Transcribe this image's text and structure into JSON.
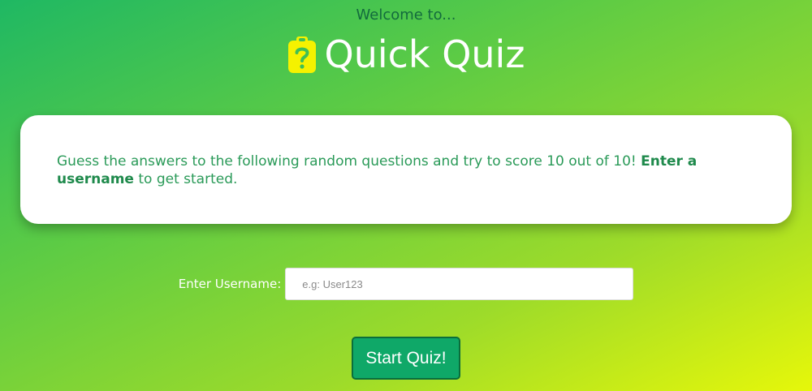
{
  "header": {
    "welcome": "Welcome to...",
    "title": "Quick Quiz",
    "icon": "clipboard-question-icon"
  },
  "intro": {
    "text_before": "Guess the answers to the following random questions and try to score 10 out of 10! ",
    "text_bold": "Enter a username",
    "text_after": " to get started."
  },
  "form": {
    "username_label": "Enter Username:",
    "username_placeholder": "e.g: User123",
    "username_value": ""
  },
  "actions": {
    "start_label": "Start Quiz!"
  },
  "colors": {
    "gradient_start": "#1fb863",
    "gradient_end": "#e6f70a",
    "icon": "#f5f200",
    "accent_text": "#2a9a58",
    "button": "#0fa868"
  }
}
